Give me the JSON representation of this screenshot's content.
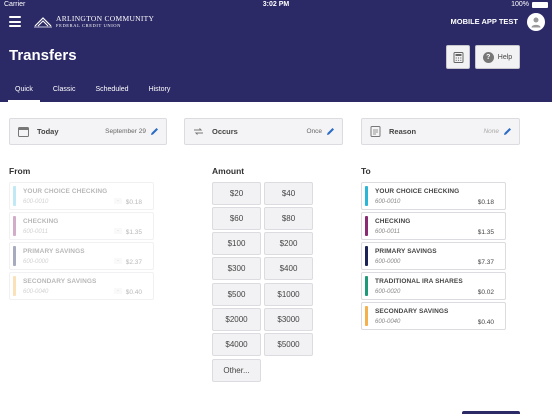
{
  "status_bar": {
    "carrier": "Carrier",
    "time": "3:02 PM",
    "battery": "100%"
  },
  "header": {
    "logo_line1": "ARLINGTON COMMUNITY",
    "logo_line2": "FEDERAL CREDIT UNION",
    "user_name": "MOBILE APP TEST",
    "title": "Transfers",
    "help_label": "Help",
    "tabs": [
      {
        "label": "Quick",
        "active": true
      },
      {
        "label": "Classic",
        "active": false
      },
      {
        "label": "Scheduled",
        "active": false
      },
      {
        "label": "History",
        "active": false
      }
    ]
  },
  "options": {
    "date": {
      "label": "Today",
      "value": "September 29"
    },
    "occurs": {
      "label": "Occurs",
      "value": "Once"
    },
    "reason": {
      "label": "Reason",
      "placeholder": "None"
    }
  },
  "from": {
    "title": "From",
    "accounts": [
      {
        "name": "YOUR CHOICE CHECKING",
        "number": "600-0010",
        "dash": "-",
        "balance": "$0.18",
        "color": "#5bc8e6"
      },
      {
        "name": "CHECKING",
        "number": "600-0011",
        "dash": "-",
        "balance": "$1.35",
        "color": "#8b2a72"
      },
      {
        "name": "PRIMARY SAVINGS",
        "number": "600-0000",
        "dash": "-",
        "balance": "$2.37",
        "color": "#1c2356"
      },
      {
        "name": "SECONDARY SAVINGS",
        "number": "600-0040",
        "dash": "-",
        "balance": "$0.40",
        "color": "#f2b14c"
      }
    ]
  },
  "amount": {
    "title": "Amount",
    "buttons": [
      "$20",
      "$40",
      "$60",
      "$80",
      "$100",
      "$200",
      "$300",
      "$400",
      "$500",
      "$1000",
      "$2000",
      "$3000",
      "$4000",
      "$5000"
    ],
    "other_label": "Other..."
  },
  "to": {
    "title": "To",
    "accounts": [
      {
        "name": "YOUR CHOICE CHECKING",
        "number": "600-0010",
        "balance": "$0.18",
        "color": "#2bb5d6"
      },
      {
        "name": "CHECKING",
        "number": "600-0011",
        "balance": "$1.35",
        "color": "#8b2a72"
      },
      {
        "name": "PRIMARY SAVINGS",
        "number": "600-0000",
        "balance": "$7.37",
        "color": "#1c2356"
      },
      {
        "name": "TRADITIONAL IRA SHARES",
        "number": "600-0020",
        "balance": "$0.02",
        "color": "#1f9a78"
      },
      {
        "name": "SECONDARY SAVINGS",
        "number": "600-0040",
        "balance": "$0.40",
        "color": "#f2b14c"
      }
    ]
  },
  "colors": {
    "brand": "#2b2966",
    "panel": "#f4f4f6"
  }
}
